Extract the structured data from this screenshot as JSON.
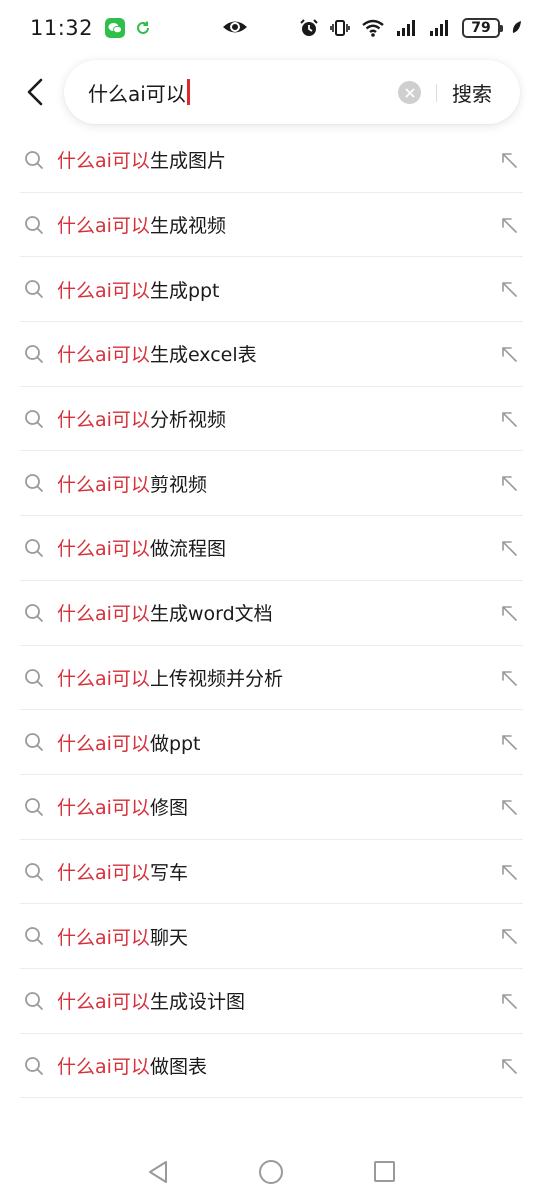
{
  "status_bar": {
    "time": "11:32",
    "battery": "79",
    "icons": [
      "wechat-icon",
      "sync-icon",
      "eye-icon",
      "alarm-icon",
      "vibrate-icon",
      "wifi-icon",
      "signal-icon",
      "signal-icon",
      "battery-icon",
      "leaf-icon"
    ]
  },
  "search": {
    "query": "什么ai可以",
    "button_label": "搜索"
  },
  "suggestions": [
    {
      "highlight": "什么ai可以",
      "rest": "生成图片"
    },
    {
      "highlight": "什么ai可以",
      "rest": "生成视频"
    },
    {
      "highlight": "什么ai可以",
      "rest": "生成ppt"
    },
    {
      "highlight": "什么ai可以",
      "rest": "生成excel表"
    },
    {
      "highlight": "什么ai可以",
      "rest": "分析视频"
    },
    {
      "highlight": "什么ai可以",
      "rest": "剪视频"
    },
    {
      "highlight": "什么ai可以",
      "rest": "做流程图"
    },
    {
      "highlight": "什么ai可以",
      "rest": "生成word文档"
    },
    {
      "highlight": "什么ai可以",
      "rest": "上传视频并分析"
    },
    {
      "highlight": "什么ai可以",
      "rest": "做ppt"
    },
    {
      "highlight": "什么ai可以",
      "rest": "修图"
    },
    {
      "highlight": "什么ai可以",
      "rest": "写车"
    },
    {
      "highlight": "什么ai可以",
      "rest": "聊天"
    },
    {
      "highlight": "什么ai可以",
      "rest": "生成设计图"
    },
    {
      "highlight": "什么ai可以",
      "rest": "做图表"
    }
  ],
  "colors": {
    "highlight": "#d6303a",
    "text": "#1a1a1a",
    "cursor": "#e02a2a"
  }
}
